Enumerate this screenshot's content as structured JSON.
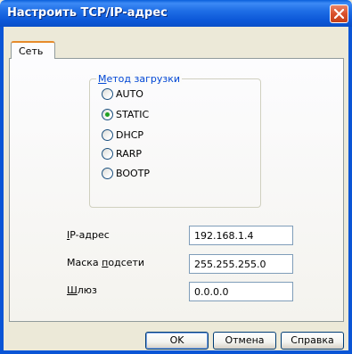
{
  "window": {
    "title": "Настроить TCP/IP-адрес"
  },
  "tabs": [
    {
      "label": "Сеть"
    }
  ],
  "boot_method": {
    "legend_prefix": "",
    "legend_u": "М",
    "legend_rest": "етод загрузки",
    "options": [
      {
        "label": "AUTO",
        "selected": false
      },
      {
        "label": "STATIC",
        "selected": true
      },
      {
        "label": "DHCP",
        "selected": false
      },
      {
        "label": "RARP",
        "selected": false
      },
      {
        "label": "BOOTP",
        "selected": false
      }
    ]
  },
  "fields": {
    "ip": {
      "label_u": "I",
      "label_rest": "P-адрес",
      "value": "192.168.1.4"
    },
    "mask": {
      "label_pre": "Маска ",
      "label_u": "п",
      "label_rest": "одсети",
      "value": "255.255.255.0"
    },
    "gateway": {
      "label_u": "Ш",
      "label_rest": "люз",
      "value": "0.0.0.0"
    }
  },
  "buttons": {
    "ok": "OK",
    "cancel": "Отмена",
    "help": "Справка"
  },
  "colors": {
    "titlebar": "#0a5fdc",
    "close_button": "#d9502b",
    "legend_text": "#0046d5",
    "tab_highlight": "#e68b2c"
  },
  "icons": {
    "close": "close-icon"
  }
}
